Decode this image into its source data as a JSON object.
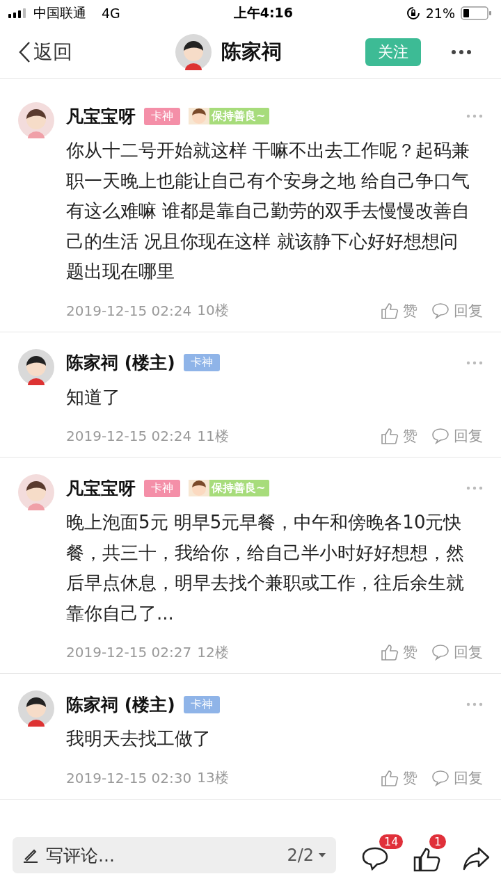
{
  "status_bar": {
    "carrier": "中国联通",
    "network": "4G",
    "time": "上午4:16",
    "battery": "21%"
  },
  "nav": {
    "back": "返回",
    "title": "陈家祠",
    "follow": "关注"
  },
  "comments": [
    {
      "author": "凡宝宝呀",
      "badge": "卡神",
      "color": "#f48fa8",
      "sticker": "保持善良~",
      "text": "你从十二号开始就这样 干嘛不出去工作呢？起码兼职一天晚上也能让自己有个安身之地 给自己争口气有这么难嘛 谁都是靠自己勤劳的双手去慢慢改善自己的生活 况且你现在这样 就该静下心好好想想问题出现在哪里",
      "date": "2019-12-15 02:24",
      "floor": "10楼",
      "like": "赞",
      "reply": "回复"
    },
    {
      "author": "陈家祠 (楼主)",
      "badge": "卡神",
      "color": "#8fb4e8",
      "text": "知道了",
      "date": "2019-12-15 02:24",
      "floor": "11楼",
      "like": "赞",
      "reply": "回复"
    },
    {
      "author": "凡宝宝呀",
      "badge": "卡神",
      "color": "#f48fa8",
      "sticker": "保持善良~",
      "text": "晚上泡面5元 明早5元早餐，中午和傍晚各10元快餐，共三十，我给你，给自己半小时好好想想，然后早点休息，明早去找个兼职或工作，往后余生就靠你自己了...",
      "date": "2019-12-15 02:27",
      "floor": "12楼",
      "like": "赞",
      "reply": "回复"
    },
    {
      "author": "陈家祠 (楼主)",
      "badge": "卡神",
      "color": "#8fb4e8",
      "text": "我明天去找工做了",
      "date": "2019-12-15 02:30",
      "floor": "13楼",
      "like": "赞",
      "reply": "回复"
    }
  ],
  "bottom_bar": {
    "placeholder": "写评论...",
    "page": "2/2",
    "comment_count": "14",
    "like_count": "1"
  }
}
